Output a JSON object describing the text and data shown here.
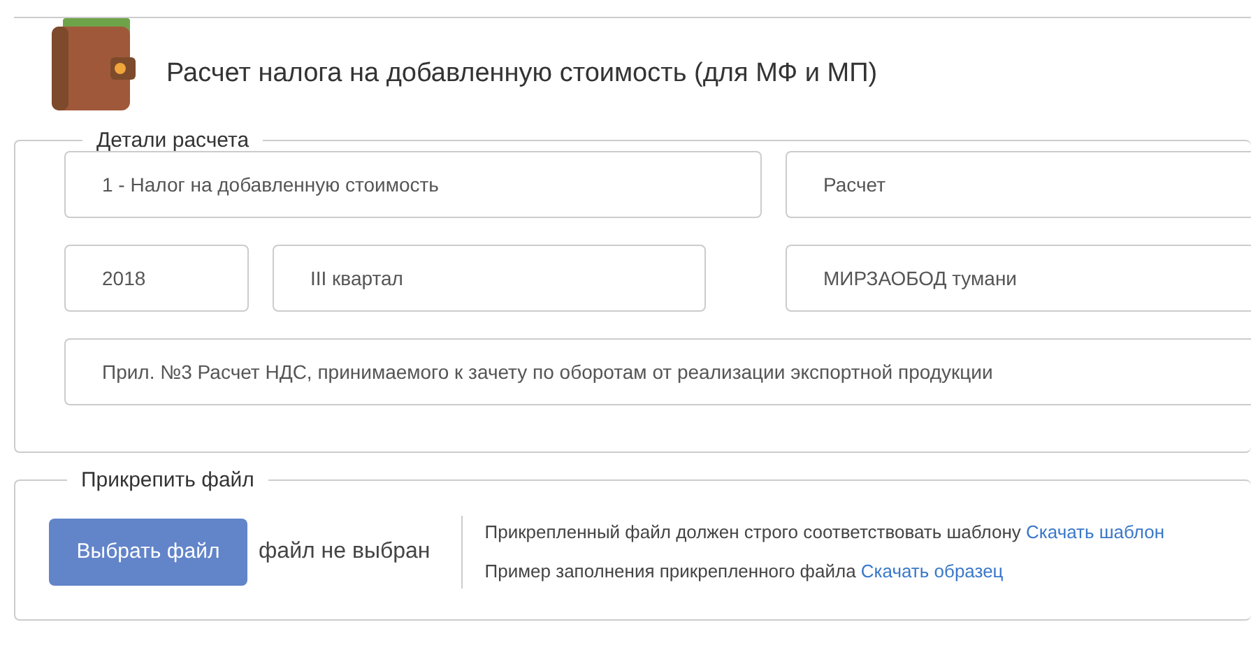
{
  "header": {
    "title": "Расчет налога на добавленную стоимость (для МФ и МП)"
  },
  "details": {
    "legend": "Детали расчета",
    "fields": [
      {
        "value": "1 - Налог на добавленную стоимость"
      },
      {
        "value": "Расчет"
      },
      {
        "value": "2018"
      },
      {
        "value": "III квартал"
      },
      {
        "value": "МИРЗАОБОД тумани"
      },
      {
        "value": "Прил. №3 Расчет НДС, принимаемого к зачету по оборотам от реализации экспортной продукции"
      }
    ]
  },
  "attach": {
    "legend": "Прикрепить файл",
    "button": "Выбрать файл",
    "file_status": "файл не выбран",
    "notes": [
      {
        "text": "Прикрепленный файл должен строго соответствовать шаблону",
        "link": "Скачать шаблон"
      },
      {
        "text": "Пример заполнения прикрепленного файла",
        "link": "Скачать образец"
      }
    ]
  }
}
